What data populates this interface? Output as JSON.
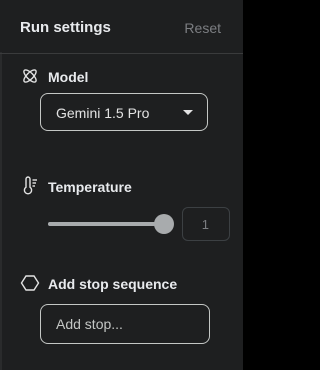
{
  "header": {
    "title": "Run settings",
    "reset_label": "Reset"
  },
  "model": {
    "label": "Model",
    "icon": "model-spark-icon",
    "selected": "Gemini 1.5 Pro"
  },
  "temperature": {
    "label": "Temperature",
    "icon": "thermometer-icon",
    "value": "1",
    "slider_fraction": 1.0
  },
  "stop_sequence": {
    "label": "Add stop sequence",
    "icon": "hexagon-icon",
    "placeholder": "Add stop..."
  },
  "colors": {
    "panel_bg": "#1e1f20",
    "text": "#e3e3e3",
    "muted": "#7c7e82",
    "slider": "#a8abad"
  }
}
